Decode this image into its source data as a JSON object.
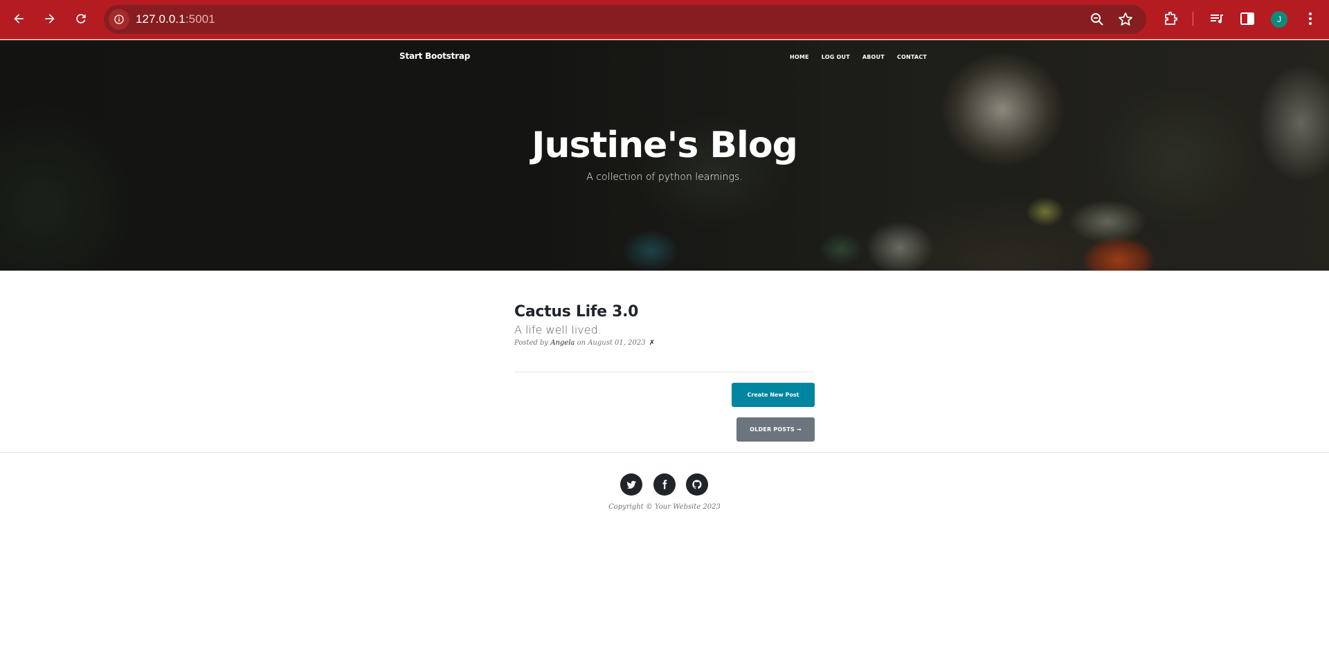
{
  "browser": {
    "url_host": "127.0.0.1",
    "url_port": ":5001",
    "profile_initial": "J",
    "theme_color": "#b51c22"
  },
  "navbar": {
    "brand": "Start Bootstrap",
    "links": [
      "HOME",
      "LOG OUT",
      "ABOUT",
      "CONTACT"
    ]
  },
  "hero": {
    "title": "Justine's Blog",
    "subtitle": "A collection of python learnings."
  },
  "post": {
    "title": "Cactus Life 3.0",
    "subtitle": "A life well lived.",
    "meta_prefix": "Posted by ",
    "author": "Angela",
    "meta_date": " on August 01, 2023 ",
    "delete_glyph": "✗"
  },
  "buttons": {
    "create": "Create New Post",
    "older": "OLDER POSTS →"
  },
  "footer": {
    "social_icons": [
      "twitter-icon",
      "facebook-icon",
      "github-icon"
    ],
    "copyright": "Copyright © Your Website 2023"
  },
  "colors": {
    "primary_button": "#0085a1",
    "secondary_button": "#6c757d",
    "social_circle": "#212529"
  }
}
